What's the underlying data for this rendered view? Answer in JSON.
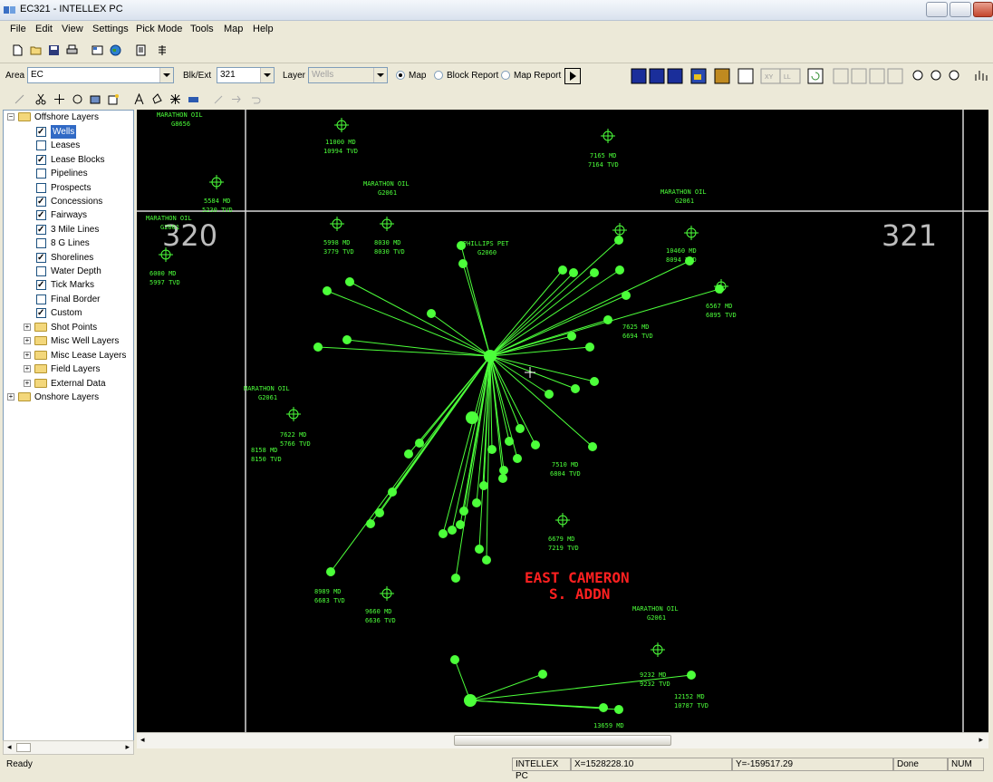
{
  "window": {
    "title": "EC321 - INTELLEX PC"
  },
  "menu": [
    {
      "label": "File"
    },
    {
      "label": "Edit"
    },
    {
      "label": "View"
    },
    {
      "label": "Settings"
    },
    {
      "label": "Pick Mode"
    },
    {
      "label": "Tools"
    },
    {
      "label": "Map"
    },
    {
      "label": "Help"
    }
  ],
  "toolbar": {
    "area_label": "Area",
    "area_value": "EC",
    "blkext_label": "Blk/Ext",
    "blkext_value": "321",
    "layer_label": "Layer",
    "layer_value": "Wells",
    "radio_map": "Map",
    "radio_block_report": "Block Report",
    "radio_map_report": "Map Report",
    "xy_label": "XY",
    "ll_label": "LL"
  },
  "tree": {
    "root_offshore": "Offshore Layers",
    "root_onshore": "Onshore Layers",
    "layers": [
      {
        "label": "Wells",
        "checked": true,
        "selected": true
      },
      {
        "label": "Leases",
        "checked": false
      },
      {
        "label": "Lease Blocks",
        "checked": true
      },
      {
        "label": "Pipelines",
        "checked": false
      },
      {
        "label": "Prospects",
        "checked": false
      },
      {
        "label": "Concessions",
        "checked": true
      },
      {
        "label": "Fairways",
        "checked": true
      },
      {
        "label": "3 Mile Lines",
        "checked": true
      },
      {
        "label": "8 G Lines",
        "checked": false
      },
      {
        "label": "Shorelines",
        "checked": true
      },
      {
        "label": "Water Depth",
        "checked": false
      },
      {
        "label": "Tick Marks",
        "checked": true
      },
      {
        "label": "Final Border",
        "checked": false
      },
      {
        "label": "Custom",
        "checked": true
      }
    ],
    "groups": [
      "Shot Points",
      "Misc Well Layers",
      "Misc Lease Layers",
      "Field Layers",
      "External Data"
    ]
  },
  "map": {
    "block_left": "320",
    "block_right": "321",
    "area_name_line1": "EAST CAMERON",
    "area_name_line2": "S. ADDN",
    "operator_labels": [
      {
        "text": "MARATHON OIL",
        "sub": "G8656"
      },
      {
        "text": "MARATHON OIL",
        "sub": "G2061"
      },
      {
        "text": "MARATHON OIL",
        "sub": "G2061"
      },
      {
        "text": "MARATHON OIL",
        "sub": "G2061"
      },
      {
        "text": "PHILLIPS PET",
        "sub": "G2060"
      },
      {
        "text": "MARATHON OIL",
        "sub": "G2061"
      },
      {
        "text": "MARATHON OIL",
        "sub": "G2061"
      }
    ],
    "well_labels": [
      "11000 MD",
      "10994 TVD",
      "7165 MD",
      "7164 TVD",
      "5584 MD",
      "5230 TVD",
      "5998 MD",
      "3779 TVD",
      "8030 MD",
      "8030 TVD",
      "6000 MD",
      "5997 TVD",
      "10460 MD",
      "8094 TVD",
      "6567 MD",
      "6895 TVD",
      "7625 MD",
      "6694 TVD",
      "7510 MD",
      "6804 TVD",
      "8158 MD",
      "8150 TVD",
      "7622 MD",
      "5766 TVD",
      "9232 MD",
      "9232 TVD",
      "12152 MD",
      "10787 TVD",
      "6679 MD",
      "7219 TVD",
      "8989 MD",
      "6683 TVD",
      "9660 MD",
      "6636 TVD",
      "13659 MD"
    ]
  },
  "status": {
    "ready": "Ready",
    "app": "INTELLEX PC",
    "x": "X=1528228.10",
    "y": "Y=-159517.29",
    "done": "Done",
    "num": "NUM"
  }
}
